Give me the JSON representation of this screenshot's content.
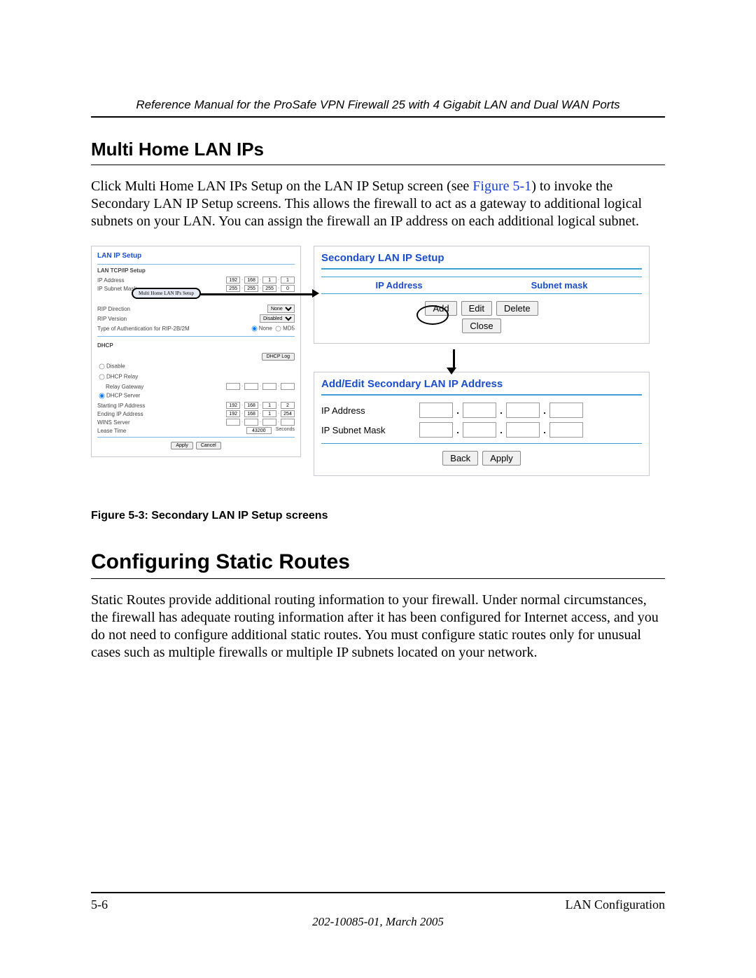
{
  "doc_header": "Reference Manual for the ProSafe VPN Firewall 25 with 4 Gigabit LAN and Dual WAN Ports",
  "section1_title": "Multi Home LAN IPs",
  "section1_body_a": "Click Multi Home LAN IPs Setup on the LAN IP Setup screen (see ",
  "section1_xref": "Figure 5-1",
  "section1_body_b": ") to invoke the Secondary LAN IP Setup screens. This allows the firewall to act as a gateway to additional logical subnets on your LAN. You can assign the firewall an IP address on each additional logical subnet.",
  "figure_caption": "Figure 5-3:  Secondary LAN IP Setup screens",
  "lan_panel": {
    "title": "LAN IP Setup",
    "tcpip_label": "LAN TCP/IP Setup",
    "ip_address_label": "IP Address",
    "ip_address": [
      "192",
      "168",
      "1",
      "1"
    ],
    "subnet_label": "IP Subnet Mask",
    "subnet": [
      "255",
      "255",
      "255",
      "0"
    ],
    "multi_home_btn": "Multi Home LAN IPs Setup",
    "rip_dir_label": "RIP Direction",
    "rip_dir_value": "None",
    "rip_ver_label": "RIP Version",
    "rip_ver_value": "Disabled",
    "auth_label": "Type of Authentication for RIP-2B/2M",
    "auth_opt_none": "None",
    "auth_opt_md5": "MD5",
    "dhcp_label": "DHCP",
    "dhcp_log_btn": "DHCP Log",
    "opt_disable": "Disable",
    "opt_relay": "DHCP Relay",
    "relay_gw_label": "Relay Gateway",
    "opt_server": "DHCP Server",
    "start_ip_label": "Starting IP Address",
    "start_ip": [
      "192",
      "168",
      "1",
      "2"
    ],
    "end_ip_label": "Ending IP Address",
    "end_ip": [
      "192",
      "168",
      "1",
      "254"
    ],
    "wins_label": "WINS Server",
    "lease_label": "Lease Time",
    "lease_value": "43200",
    "lease_unit": "Seconds",
    "apply_btn": "Apply",
    "cancel_btn": "Cancel"
  },
  "secondary_panel": {
    "title": "Secondary LAN IP Setup",
    "col_ip": "IP Address",
    "col_mask": "Subnet mask",
    "add_btn": "Add",
    "edit_btn": "Edit",
    "delete_btn": "Delete",
    "close_btn": "Close"
  },
  "addedit_panel": {
    "title": "Add/Edit Secondary LAN IP Address",
    "ip_label": "IP Address",
    "mask_label": "IP Subnet Mask",
    "back_btn": "Back",
    "apply_btn": "Apply"
  },
  "section2_title": "Configuring Static Routes",
  "section2_body": "Static Routes provide additional routing information to your firewall. Under normal circumstances, the firewall has adequate routing information after it has been configured for Internet access, and you do not need to configure additional static routes. You must configure static routes only for unusual cases such as multiple firewalls or multiple IP subnets located on your network.",
  "footer": {
    "page_num": "5-6",
    "chapter": "LAN Configuration",
    "docid": "202-10085-01, March 2005"
  }
}
